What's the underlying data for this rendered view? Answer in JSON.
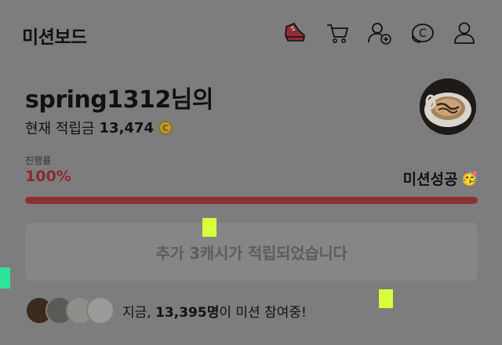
{
  "header": {
    "title": "미션보드",
    "icons": [
      "sneaker-icon",
      "cart-icon",
      "add-friend-icon",
      "cash-coin-icon",
      "profile-icon"
    ]
  },
  "user": {
    "name": "spring1312님의",
    "balance_label": "현재 적립금",
    "balance_value": "13,474",
    "coin_symbol": "C"
  },
  "progress": {
    "label": "진행률",
    "percent_text": "100%",
    "fraction": 1.0,
    "status": "미션성공",
    "status_emoji": "🥳"
  },
  "reward": {
    "message": "추가 3캐시가 적립되었습니다"
  },
  "participants": {
    "prefix": "지금, ",
    "count": "13,395명",
    "suffix": "이 미션 참여중!"
  },
  "colors": {
    "accent": "#8e2f33",
    "marker_yellow": "#d7ff3c",
    "marker_green": "#2fe39a"
  }
}
